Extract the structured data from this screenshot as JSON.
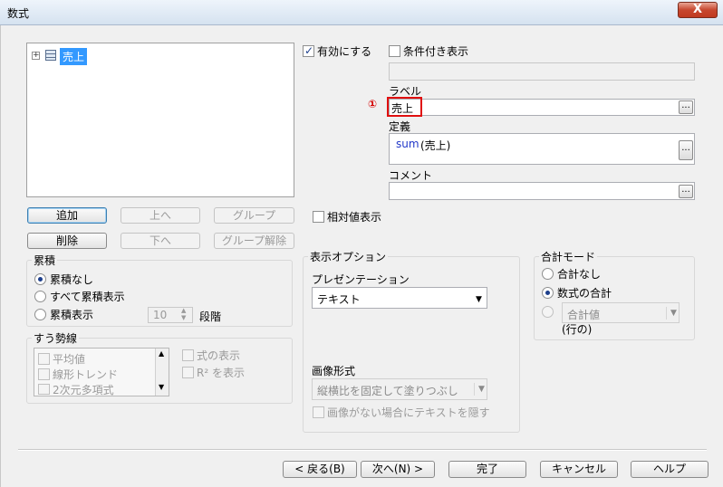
{
  "window": {
    "title": "数式",
    "close_label": "X"
  },
  "tree": {
    "expander": "+",
    "selected_item": "売上"
  },
  "left_buttons": {
    "add": "追加",
    "up": "上へ",
    "group": "グループ",
    "delete": "削除",
    "down": "下へ",
    "ungroup": "グループ解除"
  },
  "accumulation": {
    "title": "累積",
    "options": [
      "累積なし",
      "すべて累積表示",
      "累積表示"
    ],
    "selected": "累積なし",
    "steps_value": "10",
    "steps_label": "段階"
  },
  "trendlines": {
    "title": "すう勢線",
    "items": [
      "平均値",
      "線形トレンド",
      "2次元多項式"
    ],
    "show_formula": "式の表示",
    "show_r2": "R² を表示"
  },
  "enable": {
    "label": "有効にする",
    "checked": true
  },
  "conditional": {
    "label": "条件付き表示",
    "checked": false,
    "value": ""
  },
  "label_field": {
    "title": "ラベル",
    "value": "売上",
    "marker": "①"
  },
  "definition": {
    "title": "定義",
    "func": "sum",
    "arg": "(売上)"
  },
  "comment": {
    "title": "コメント",
    "value": ""
  },
  "relative": {
    "label": "相対値表示",
    "checked": false
  },
  "display_options": {
    "title": "表示オプション",
    "presentation_label": "プレゼンテーション",
    "presentation_value": "テキスト",
    "image_format_label": "画像形式",
    "image_format_value": "縦横比を固定して塗りつぶし",
    "no_image_text_label": "画像がない場合にテキストを隠す"
  },
  "total_mode": {
    "title": "合計モード",
    "options": [
      "合計なし",
      "数式の合計"
    ],
    "selected": "数式の合計",
    "third_value": "合計値",
    "third_sub": "(行の)"
  },
  "footer": {
    "back": "< 戻る(B)",
    "next": "次へ(N) >",
    "finish": "完了",
    "cancel": "キャンセル",
    "help": "ヘルプ"
  },
  "icons": [
    "close-icon",
    "expand-icon",
    "table-icon",
    "ellipsis-icon",
    "dropdown-arrow-icon",
    "spin-icon",
    "scroll-arrow-icon"
  ]
}
